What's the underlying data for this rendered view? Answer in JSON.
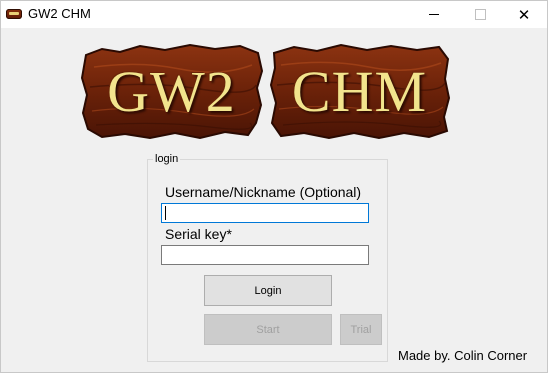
{
  "window": {
    "title": "GW2 CHM",
    "icon": "gw2-chm-app-icon",
    "controls": {
      "minimize_icon": "minimize-icon",
      "maximize_icon": "maximize-icon",
      "close_icon": "close-icon",
      "close_glyph": "✕"
    }
  },
  "logo": {
    "left_text": "GW2",
    "right_text": "CHM"
  },
  "login_group": {
    "legend": "login",
    "username_label": "Username/Nickname (Optional)",
    "username_value": "",
    "serial_label": "Serial key*",
    "serial_value": "",
    "login_button": "Login",
    "start_button": "Start",
    "trial_button": "Trial"
  },
  "footer": {
    "credit": "Made by. Colin Corner"
  },
  "colors": {
    "background": "#f0f0f0",
    "logo_wood": "#6b2209",
    "logo_text": "#f2e48d",
    "focus_border": "#0078d7"
  }
}
